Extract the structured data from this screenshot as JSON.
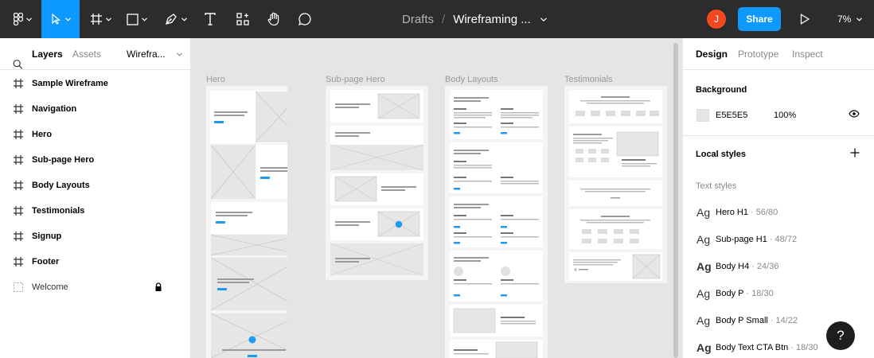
{
  "topbar": {
    "breadcrumb_root": "Drafts",
    "breadcrumb_sep": "/",
    "file_name": "Wireframing ...",
    "avatar_initial": "J",
    "share_label": "Share",
    "zoom_label": "7%",
    "tools": [
      "figma-menu-icon",
      "move-tool-icon",
      "frame-tool-icon",
      "shape-tool-icon",
      "pen-tool-icon",
      "text-tool-icon",
      "resources-icon",
      "hand-tool-icon",
      "comment-tool-icon"
    ]
  },
  "left_panel": {
    "tab_layers": "Layers",
    "tab_assets": "Assets",
    "page_selector": "Wirefra...",
    "layers": [
      {
        "label": "Sample Wireframe"
      },
      {
        "label": "Navigation"
      },
      {
        "label": "Hero"
      },
      {
        "label": "Sub-page Hero"
      },
      {
        "label": "Body Layouts"
      },
      {
        "label": "Testimonials"
      },
      {
        "label": "Signup"
      },
      {
        "label": "Footer"
      },
      {
        "label": "Welcome",
        "locked": true
      }
    ]
  },
  "canvas": {
    "frames": [
      {
        "label": "Hero"
      },
      {
        "label": "Sub-page Hero"
      },
      {
        "label": "Body Layouts"
      },
      {
        "label": "Testimonials"
      }
    ]
  },
  "right_panel": {
    "tab_design": "Design",
    "tab_prototype": "Prototype",
    "tab_inspect": "Inspect",
    "background_title": "Background",
    "background_hex": "E5E5E5",
    "background_opacity": "100%",
    "local_styles_title": "Local styles",
    "text_styles_title": "Text styles",
    "text_styles": [
      {
        "ag": "Ag",
        "name": "Hero H1",
        "meta": "· 56/80",
        "bold": false
      },
      {
        "ag": "Ag",
        "name": "Sub-page H1",
        "meta": "· 48/72",
        "bold": false
      },
      {
        "ag": "Ag",
        "name": "Body H4",
        "meta": "· 24/36",
        "bold": true
      },
      {
        "ag": "Ag",
        "name": "Body P",
        "meta": "· 18/30",
        "bold": false
      },
      {
        "ag": "Ag",
        "name": "Body P Small",
        "meta": "· 14/22",
        "bold": false
      },
      {
        "ag": "Ag",
        "name": "Body Text CTA Btn",
        "meta": "· 18/30",
        "bold": true
      }
    ]
  },
  "help_label": "?",
  "colors": {
    "accent": "#0d99ff",
    "toolbar": "#2c2c2c",
    "avatar": "#f24822",
    "canvas": "#e5e5e5"
  }
}
